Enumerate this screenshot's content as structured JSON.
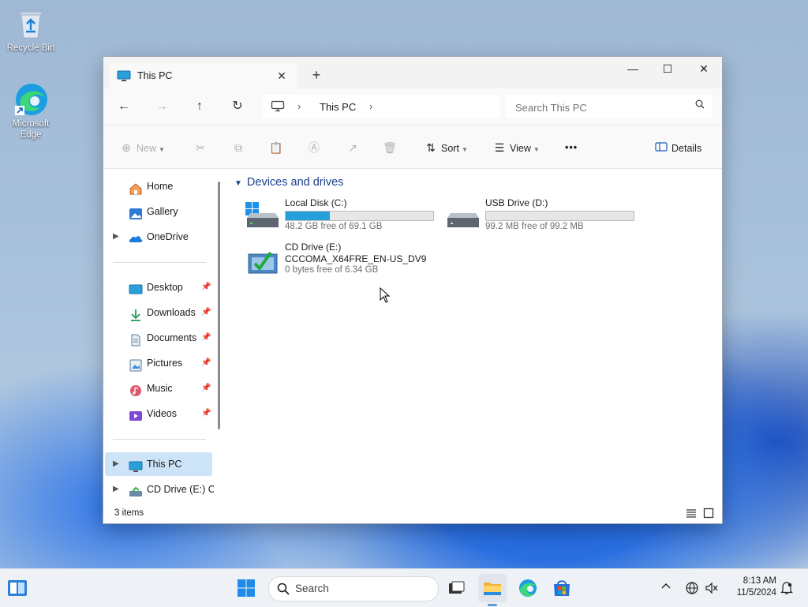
{
  "desktop": {
    "icons": [
      {
        "label": "Recycle Bin"
      },
      {
        "label": "Microsoft Edge"
      }
    ]
  },
  "window": {
    "tab_title": "This PC",
    "tab_close": "✕",
    "new_tab": "+",
    "controls": {
      "minimize": "—",
      "maximize": "☐",
      "close": "✕"
    },
    "nav": {
      "back": "←",
      "forward": "→",
      "up": "↑",
      "refresh": "↻"
    },
    "breadcrumb": {
      "item": "This PC",
      "sep": "›"
    },
    "search": {
      "placeholder": "Search This PC",
      "value": ""
    },
    "commands": {
      "new": "New",
      "sort": "Sort",
      "view": "View",
      "more": "•••",
      "details": "Details"
    },
    "sidebar": {
      "items": [
        {
          "label": "Home",
          "icon": "home-icon"
        },
        {
          "label": "Gallery",
          "icon": "gallery-icon"
        },
        {
          "label": "OneDrive",
          "icon": "onedrive-icon"
        },
        {
          "label": "Desktop",
          "icon": "desktop-icon"
        },
        {
          "label": "Downloads",
          "icon": "download-icon"
        },
        {
          "label": "Documents",
          "icon": "document-icon"
        },
        {
          "label": "Pictures",
          "icon": "pictures-icon"
        },
        {
          "label": "Music",
          "icon": "music-icon"
        },
        {
          "label": "Videos",
          "icon": "videos-icon"
        },
        {
          "label": "This PC",
          "icon": "pc-icon"
        },
        {
          "label": "CD Drive (E:) CC",
          "icon": "cd-drive-icon"
        }
      ]
    },
    "group_header": "Devices and drives",
    "drives": [
      {
        "name": "Local Disk (C:)",
        "free": "48.2 GB free of 69.1 GB",
        "used_fraction": 0.3
      },
      {
        "name": "USB Drive (D:)",
        "free": "99.2 MB free of 99.2 MB",
        "used_fraction": 0.0
      },
      {
        "name": "CD Drive (E:)",
        "subtitle": "CCCOMA_X64FRE_EN-US_DV9",
        "free": "0 bytes free of 6.34 GB"
      }
    ],
    "status": {
      "count": "3 items"
    }
  },
  "taskbar": {
    "search_label": "Search",
    "time": "8:13 AM",
    "date": "11/5/2024"
  },
  "colors": {
    "accent": "#26a0da",
    "selection": "#cde3f7",
    "header": "#1a3f8a"
  }
}
